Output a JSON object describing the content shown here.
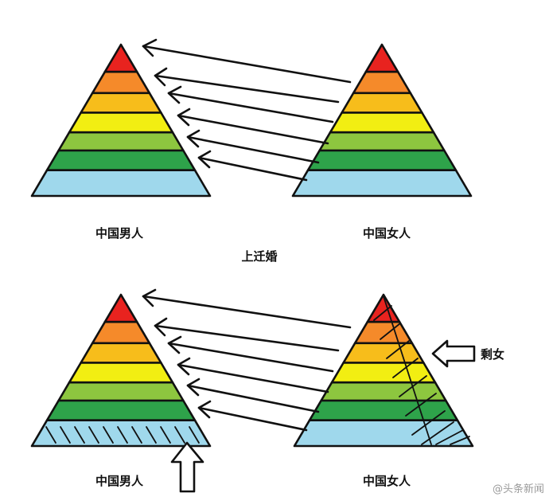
{
  "labels": {
    "men_top": "中国男人",
    "women_top": "中国女人",
    "caption": "上迁婚",
    "men_bottom": "中国男人",
    "women_bottom": "中国女人",
    "leftover_women": "剩女",
    "watermark": "@头条新闻"
  },
  "layer_colors": [
    "#e8231f",
    "#f58a2a",
    "#f7bd1b",
    "#f2ee12",
    "#8dc63f",
    "#2ea34a",
    "#9fd8ec"
  ],
  "line_color": "#111111"
}
